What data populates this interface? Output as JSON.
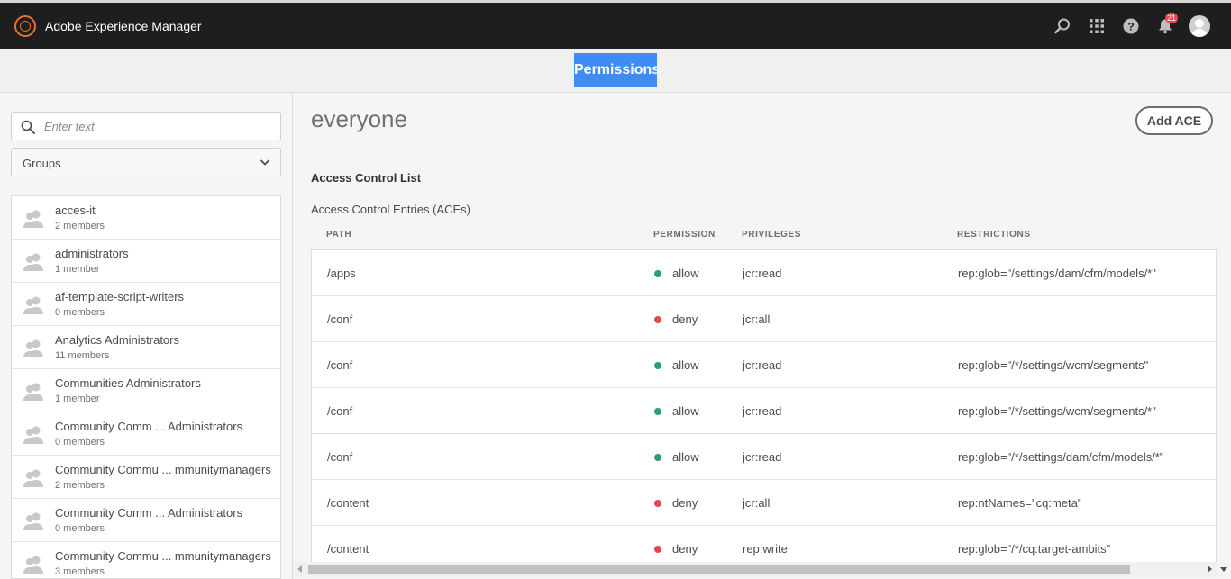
{
  "shell": {
    "app_title": "Adobe Experience Manager",
    "notification_count": "21",
    "icons": [
      "search-icon",
      "apps-grid-icon",
      "help-icon",
      "bell-icon",
      "user-avatar"
    ]
  },
  "titlebar": {
    "title": "Permissions"
  },
  "rail": {
    "search_placeholder": "Enter text",
    "filter_value": "Groups",
    "items": [
      {
        "name": "acces-it",
        "members": "2 members"
      },
      {
        "name": "administrators",
        "members": "1 member"
      },
      {
        "name": "af-template-script-writers",
        "members": "0 members"
      },
      {
        "name": "Analytics Administrators",
        "members": "11 members"
      },
      {
        "name": "Communities Administrators",
        "members": "1 member"
      },
      {
        "name": "Community Comm ... Administrators",
        "members": "0 members"
      },
      {
        "name": "Community Commu ... mmunitymanagers",
        "members": "2 members"
      },
      {
        "name": "Community Comm ... Administrators",
        "members": "0 members"
      },
      {
        "name": "Community Commu ... mmunitymanagers",
        "members": "3 members"
      }
    ]
  },
  "main": {
    "principal": "everyone",
    "add_ace_label": "Add ACE",
    "acl_title": "Access Control List",
    "aces_title": "Access Control Entries (ACEs)",
    "columns": {
      "path": "PATH",
      "permission": "PERMISSION",
      "privileges": "PRIVILEGES",
      "restrictions": "RESTRICTIONS"
    },
    "rows": [
      {
        "path": "/apps",
        "permission": "allow",
        "privileges": "jcr:read",
        "restrictions": "rep:glob=\"/settings/dam/cfm/models/*\""
      },
      {
        "path": "/conf",
        "permission": "deny",
        "privileges": "jcr:all",
        "restrictions": ""
      },
      {
        "path": "/conf",
        "permission": "allow",
        "privileges": "jcr:read",
        "restrictions": "rep:glob=\"/*/settings/wcm/segments\""
      },
      {
        "path": "/conf",
        "permission": "allow",
        "privileges": "jcr:read",
        "restrictions": "rep:glob=\"/*/settings/wcm/segments/*\""
      },
      {
        "path": "/conf",
        "permission": "allow",
        "privileges": "jcr:read",
        "restrictions": "rep:glob=\"/*/settings/dam/cfm/models/*\""
      },
      {
        "path": "/content",
        "permission": "deny",
        "privileges": "jcr:all",
        "restrictions": "rep:ntNames=\"cq:meta\""
      },
      {
        "path": "/content",
        "permission": "deny",
        "privileges": "rep:write",
        "restrictions": "rep:glob=\"/*/cq:target-ambits\""
      }
    ]
  },
  "colors": {
    "allow": "#2d9d78",
    "deny": "#e34850",
    "accent": "#3e8cf5",
    "logo": "#e8702a"
  }
}
